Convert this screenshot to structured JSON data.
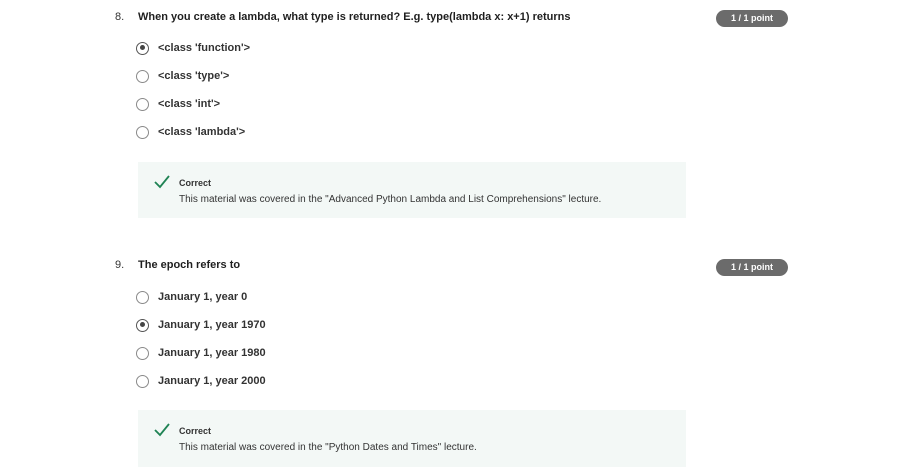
{
  "questions": [
    {
      "number": "8.",
      "text": "When you create a lambda, what type is returned? E.g. type(lambda x: x+1) returns",
      "score": "1 / 1 point",
      "options": [
        "<class 'function'>",
        "<class 'type'>",
        "<class 'int'>",
        "<class 'lambda'>"
      ],
      "selected_index": 0,
      "feedback": {
        "status": "Correct",
        "text": "This material was covered in the \"Advanced Python Lambda and List Comprehensions\" lecture."
      }
    },
    {
      "number": "9.",
      "text": "The epoch refers to",
      "score": "1 / 1 point",
      "options": [
        "January 1, year 0",
        "January 1, year 1970",
        "January 1, year 1980",
        "January 1, year 2000"
      ],
      "selected_index": 1,
      "feedback": {
        "status": "Correct",
        "text": "This material was covered in the \"Python Dates and Times\" lecture."
      }
    }
  ],
  "colors": {
    "badge_bg": "#6b6b6b",
    "feedback_bg": "#f3f8f6",
    "check_green": "#1f8354"
  }
}
